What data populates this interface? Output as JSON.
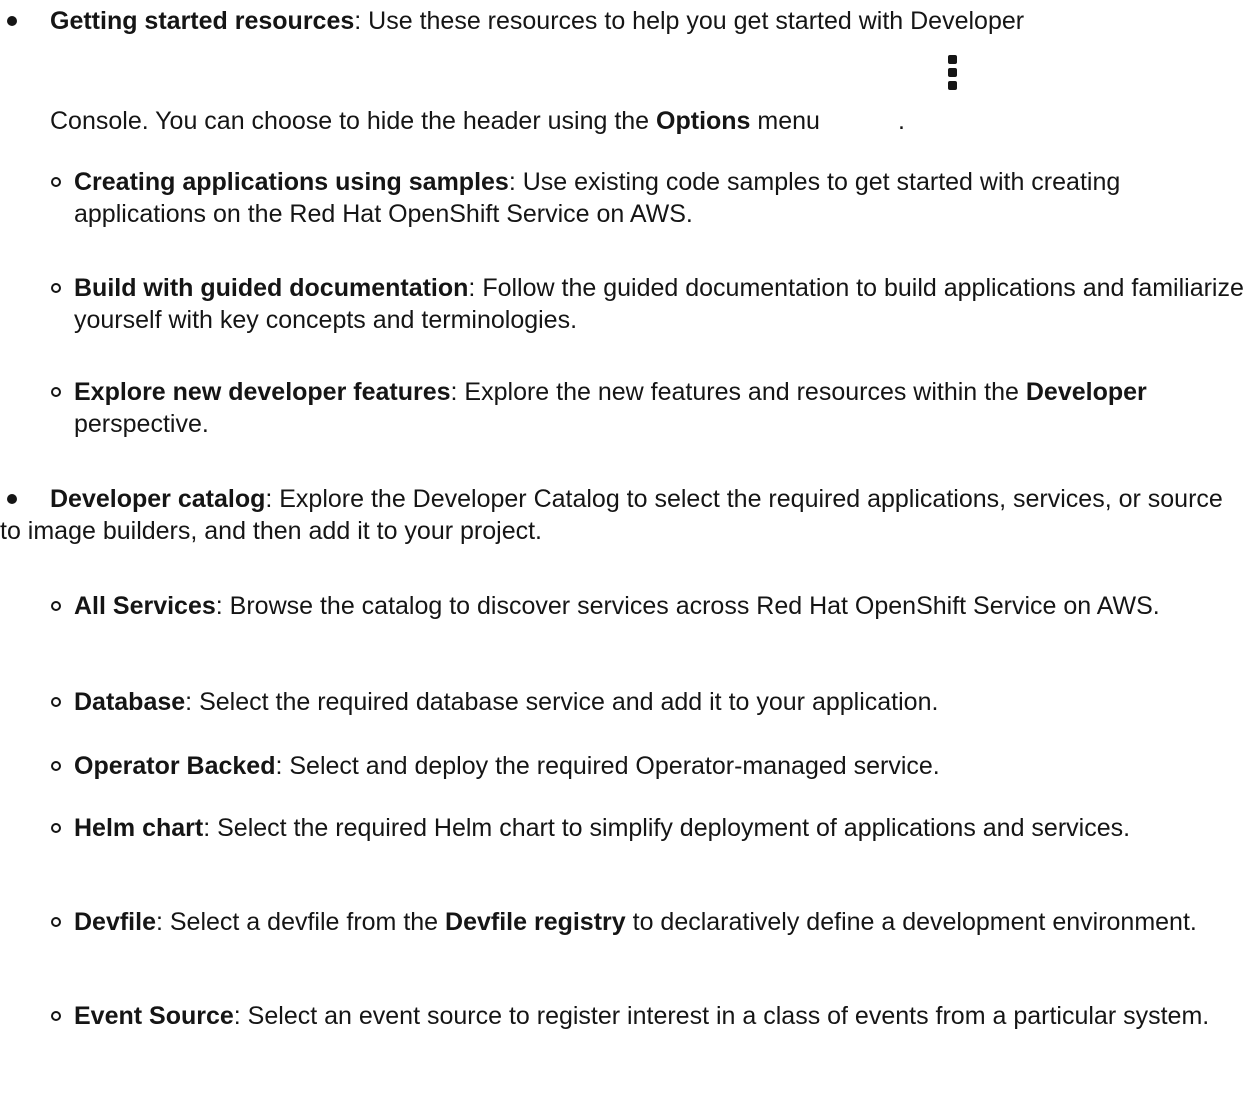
{
  "items": [
    {
      "title": "Getting started resources",
      "sep": ":",
      "line1": " Use these resources to help you get started with Developer",
      "line2_pre": "Console. You can choose to hide the header using the ",
      "options_label": "Options",
      "line2_post": " menu",
      "line2_end": ".",
      "icon": "kebab-icon",
      "children": [
        {
          "title": "Creating applications using samples",
          "sep": ":",
          "text": " Use existing code samples to get started with creating applications on the Red Hat OpenShift Service on AWS."
        },
        {
          "title": "Build with guided documentation",
          "sep": ":",
          "text": " Follow the guided documentation to build applications and familiarize yourself with key concepts and terminologies."
        },
        {
          "title": "Explore new developer features",
          "sep": ":",
          "text": " Explore the new features and resources within the ",
          "bold2": "Developer",
          "text2": " perspective."
        }
      ]
    },
    {
      "title": "Developer catalog",
      "sep": ":",
      "text": " Explore the Developer Catalog to select the required applications, services, or source to image builders, and then add it to your project.",
      "children": [
        {
          "title": "All Services",
          "sep": ":",
          "text": " Browse the catalog to discover services across Red Hat OpenShift Service on AWS."
        },
        {
          "title": "Database",
          "sep": ":",
          "text": " Select the required database service and add it to your application."
        },
        {
          "title": "Operator Backed",
          "sep": ":",
          "text": " Select and deploy the required Operator-managed service."
        },
        {
          "title": "Helm chart",
          "sep": ":",
          "text": " Select the required Helm chart to simplify deployment of applications and services."
        },
        {
          "title": "Devfile",
          "sep": ":",
          "text": " Select a devfile from the  ",
          "bold2": "Devfile registry",
          "text2": " to declaratively define a development environment."
        },
        {
          "title": "Event Source",
          "sep": ":",
          "text": " Select an event source to register interest in a class of events from a particular system."
        }
      ]
    }
  ]
}
